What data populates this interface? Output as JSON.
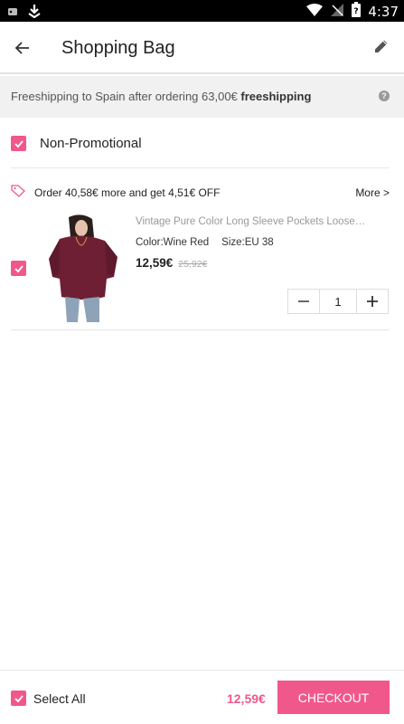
{
  "status_bar": {
    "time": "4:37",
    "icons": [
      "notification-icon",
      "download-icon",
      "wifi-icon",
      "no-signal-icon",
      "battery-icon"
    ]
  },
  "app_bar": {
    "title": "Shopping Bag",
    "back_icon": "arrow-left-icon",
    "edit_icon": "pencil-icon"
  },
  "shipping_banner": {
    "text": "Freeshipping to Spain after ordering 63,00€",
    "emphasis": "freeshipping",
    "help_icon": "?"
  },
  "group": {
    "title": "Non-Promotional",
    "checked": true
  },
  "promo": {
    "text": "Order 40,58€ more and get 4,51€ OFF",
    "more_label": "More >"
  },
  "items": [
    {
      "name": "Vintage Pure Color Long Sleeve Pockets Loose…",
      "color": "Color:Wine Red",
      "size": "Size:EU 38",
      "price": "12,59€",
      "original_price": "25,92€",
      "quantity": "1",
      "checked": true
    }
  ],
  "stepper": {
    "minus": "—",
    "plus": "+"
  },
  "bottom_bar": {
    "select_all_label": "Select All",
    "total": "12,59€",
    "checkout_label": "CHECKOUT"
  },
  "colors": {
    "accent": "#f0588c",
    "banner_bg": "#f1f1f1",
    "muted_text": "#999999"
  }
}
